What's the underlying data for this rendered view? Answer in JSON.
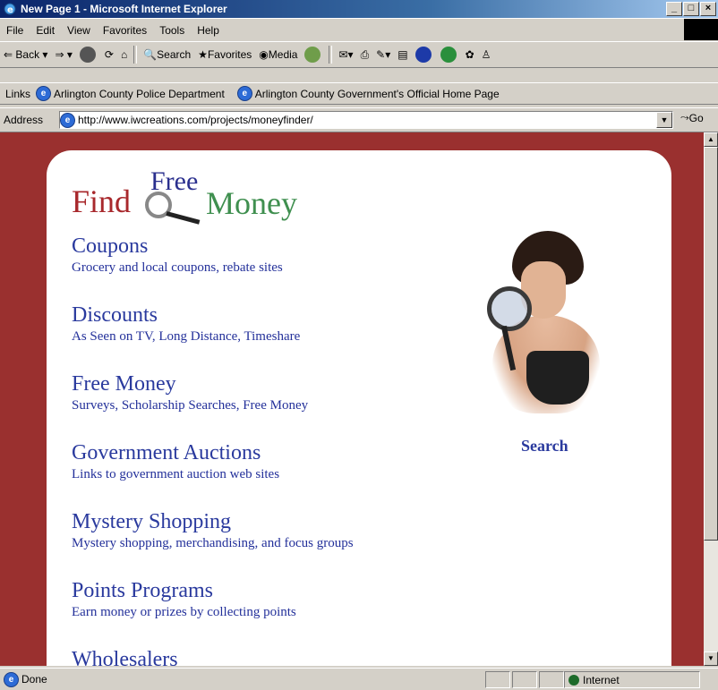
{
  "window": {
    "title": "New Page 1 - Microsoft Internet Explorer",
    "controls": [
      "_",
      "□",
      "×"
    ]
  },
  "menu": [
    "File",
    "Edit",
    "View",
    "Favorites",
    "Tools",
    "Help"
  ],
  "toolbar": {
    "back": "Back",
    "search": "Search",
    "favorites": "Favorites",
    "media": "Media"
  },
  "links": {
    "label": "Links",
    "items": [
      "Arlington County Police Department",
      "Arlington County Government's Official Home Page"
    ]
  },
  "address": {
    "label": "Address",
    "url": "http://www.iwcreations.com/projects/moneyfinder/",
    "go": "Go"
  },
  "logo": {
    "find": "Find",
    "free": "Free",
    "money": "Money"
  },
  "sections": [
    {
      "title": "Coupons",
      "desc": "Grocery and local coupons, rebate sites"
    },
    {
      "title": "Discounts",
      "desc": "As Seen on TV, Long Distance, Timeshare"
    },
    {
      "title": "Free Money",
      "desc": "Surveys, Scholarship Searches, Free Money"
    },
    {
      "title": "Government Auctions",
      "desc": "Links to government auction web sites"
    },
    {
      "title": "Mystery Shopping",
      "desc": "Mystery shopping, merchandising, and focus groups"
    },
    {
      "title": "Points Programs",
      "desc": "Earn money or prizes by collecting points"
    },
    {
      "title": "Wholesalers",
      "desc": ""
    }
  ],
  "search_link": "Search",
  "status": {
    "left": "Done",
    "zone": "Internet"
  },
  "colors": {
    "page_bg": "#9a302f",
    "link": "#2a3a9e"
  }
}
